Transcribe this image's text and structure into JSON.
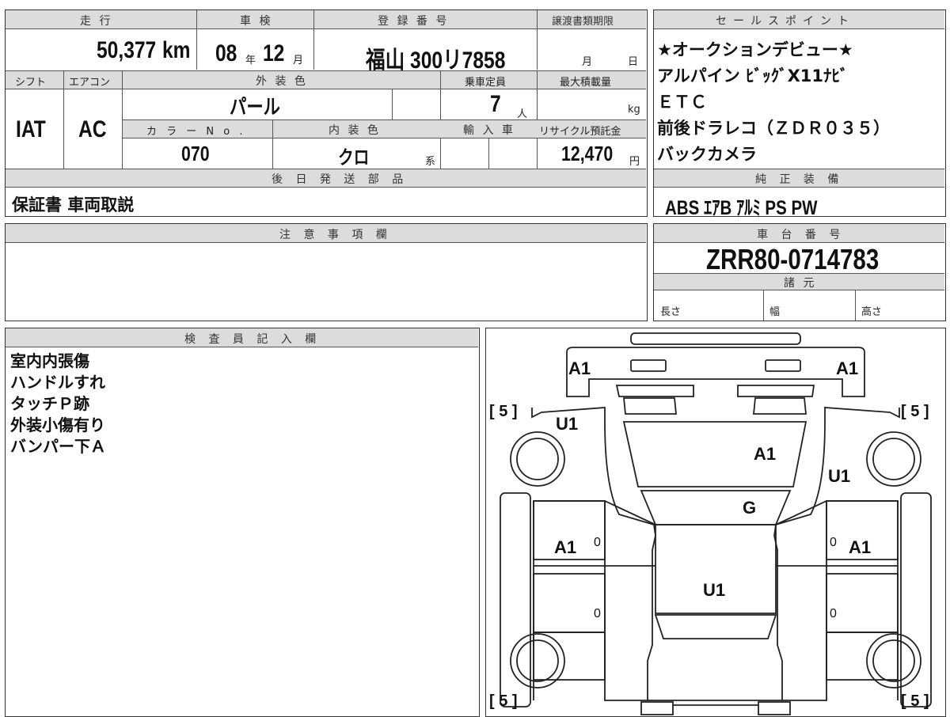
{
  "top": {
    "mileage_label": "走 行",
    "mileage": "50,377",
    "mileage_unit": "km",
    "inspection_label": "車 検",
    "insp_year": "08",
    "insp_year_unit": "年",
    "insp_month": "12",
    "insp_month_unit": "月",
    "reg_label": "登 録 番 号",
    "reg_number": "福山 300リ7858",
    "transfer_label": "譲渡書類期限",
    "transfer_month": "月",
    "transfer_day": "日",
    "shift_label": "シフト",
    "shift": "IAT",
    "ac_label": "エアコン",
    "ac": "AC",
    "color_label": "外 装 色",
    "color": "パール",
    "capacity_label": "乗車定員",
    "capacity": "7",
    "capacity_unit": "人",
    "load_label": "最大積載量",
    "load_unit": "kg",
    "color_no_label": "カ ラ ー N o .",
    "color_no": "070",
    "interior_label": "内 装 色",
    "interior": "クロ",
    "interior_suffix": "系",
    "import_label": "輸 入 車",
    "recycle_label": "リサイクル預託金",
    "recycle": "12,470",
    "recycle_unit": "円",
    "later_label": "後 日 発 送 部 品",
    "later": "保証書 車両取説"
  },
  "sales": {
    "label": "セールスポイント",
    "points": [
      "★オークションデビュー★",
      "アルパイン ﾋﾞｯｸﾞX11ﾅﾋﾞ",
      "ＥＴＣ",
      "前後ドラレコ（ＺＤＲ０３５）",
      "バックカメラ"
    ],
    "equip_label": "純 正 装 備",
    "equipment": "ABS ｴｱB ｱﾙﾐ PS PW"
  },
  "caution": {
    "label": "注 意 事 項 欄"
  },
  "chassis": {
    "label": "車 台 番 号",
    "number": "ZRR80-0714783",
    "spec_label": "諸 元",
    "length": "長さ",
    "width": "幅",
    "height": "高さ"
  },
  "inspector": {
    "label": "検 査 員 記 入 欄",
    "notes": [
      "室内内張傷",
      "ハンドルすれ",
      "タッチＰ跡",
      "外装小傷有り",
      "バンパー下Ａ"
    ]
  },
  "diagram": {
    "marks": [
      "A1",
      "A1",
      "U1",
      "A1",
      "U1",
      "G",
      "A1",
      "A1",
      "U1",
      "0",
      "0",
      "0",
      "0"
    ],
    "tire_labels": [
      "[ 5 ]",
      "[ 5 ]",
      "[ 5 ]",
      "[ 5 ]"
    ]
  }
}
